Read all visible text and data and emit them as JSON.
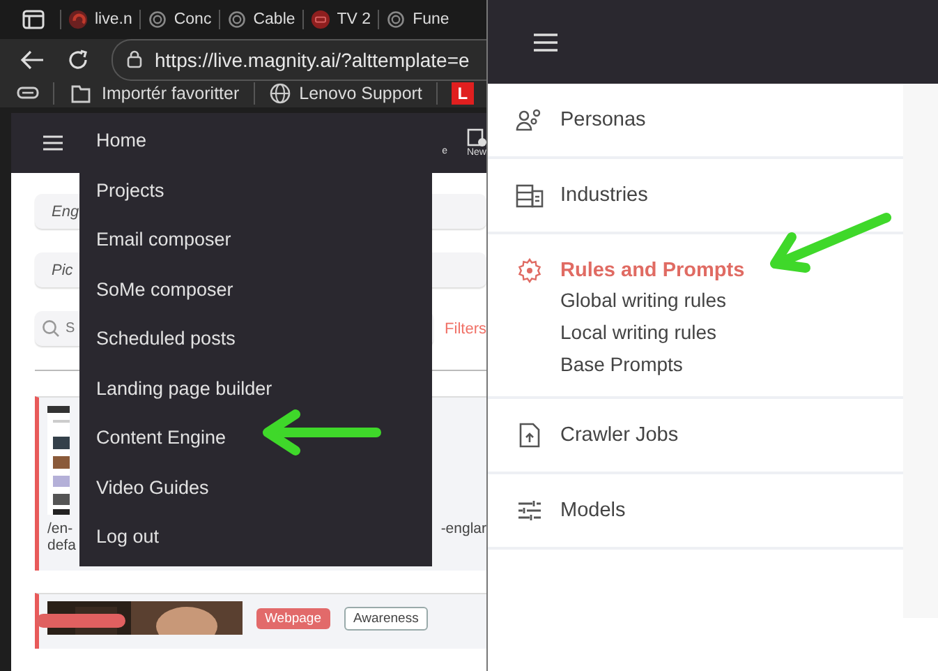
{
  "left_screenshot": {
    "browser": {
      "tabs": [
        {
          "title": "live.n",
          "kind": "site"
        },
        {
          "title": "Conc",
          "kind": "chat"
        },
        {
          "title": "Cable",
          "kind": "chat"
        },
        {
          "title": "TV 2",
          "kind": "tv"
        },
        {
          "title": "Fune",
          "kind": "chat"
        }
      ],
      "url": "https://live.magnity.ai/?alttemplate=e",
      "bookmarks": [
        {
          "label": "Importér favoritter",
          "kind": "import"
        },
        {
          "label": "Lenovo Support",
          "kind": "globe"
        },
        {
          "label": "L",
          "kind": "badge"
        }
      ]
    },
    "app": {
      "header_actions": [
        {
          "label": "e"
        },
        {
          "label": "New"
        }
      ],
      "fields": [
        {
          "placeholder": "Eng"
        },
        {
          "placeholder": "Pic"
        }
      ],
      "search": {
        "placeholder": "S"
      },
      "filters": "Filters",
      "cards": [
        {
          "text_left": "/en-",
          "text_right": "-englar",
          "text_line_2": "defa",
          "kind": "screenshot"
        },
        {
          "tags": [
            {
              "label": "Webpage",
              "kind": "filled"
            },
            {
              "label": "Awareness",
              "kind": "outline"
            }
          ]
        }
      ],
      "menu": {
        "items": [
          {
            "label": "Home",
            "selected": false
          },
          {
            "label": "Projects",
            "selected": false
          },
          {
            "label": "Email composer",
            "selected": false
          },
          {
            "label": "SoMe composer",
            "selected": false
          },
          {
            "label": "Scheduled posts",
            "selected": false
          },
          {
            "label": "Landing page builder",
            "selected": false
          },
          {
            "label": "Content Engine",
            "selected": false
          },
          {
            "label": "Video Guides",
            "selected": false
          },
          {
            "label": "Log out",
            "selected": false
          }
        ]
      }
    }
  },
  "right_screenshot": {
    "sidebar": {
      "items": [
        {
          "label": "Personas",
          "kind": "personas",
          "selected": false
        },
        {
          "label": "Industries",
          "kind": "industries",
          "selected": false
        },
        {
          "label": "Rules and Prompts",
          "kind": "rules",
          "selected": true,
          "children": [
            {
              "label": "Global writing rules"
            },
            {
              "label": "Local writing rules"
            },
            {
              "label": "Base Prompts"
            }
          ]
        },
        {
          "label": "Crawler Jobs",
          "kind": "crawler",
          "selected": false
        },
        {
          "label": "Models",
          "kind": "models",
          "selected": false
        }
      ]
    }
  }
}
